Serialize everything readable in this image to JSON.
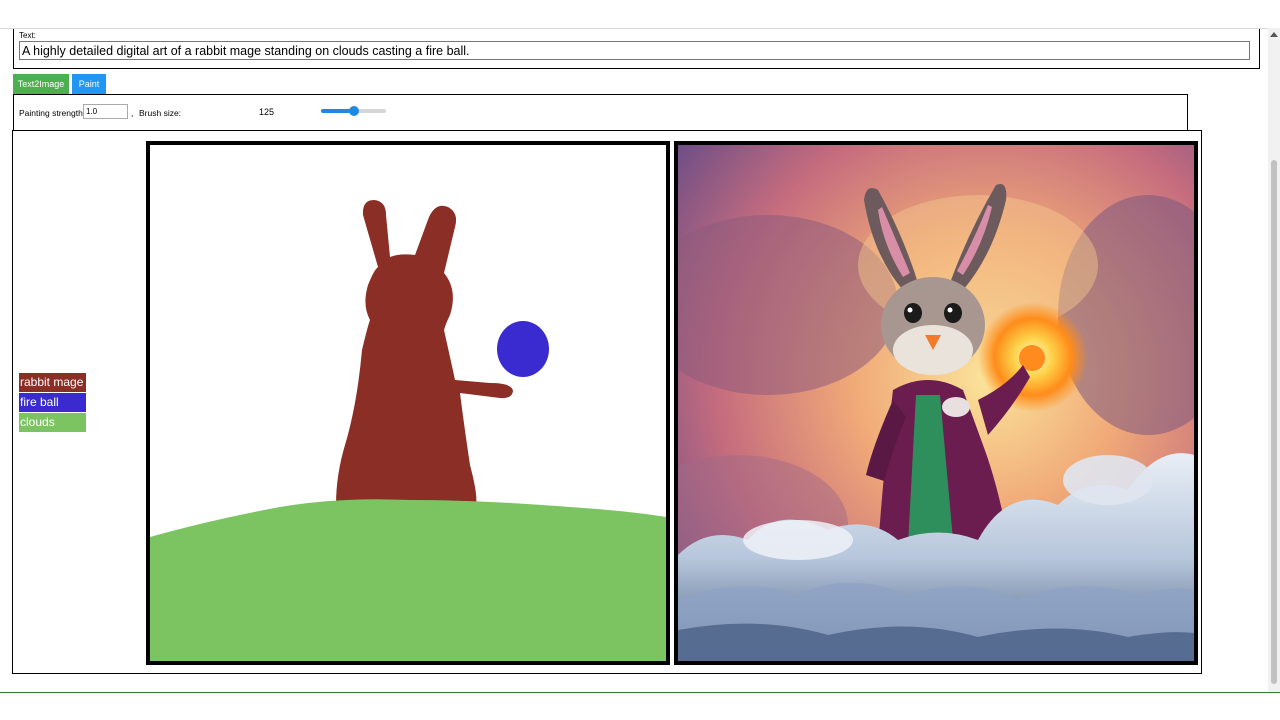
{
  "text_section": {
    "label": "Text:",
    "prompt_value": "A highly detailed digital art of a rabbit mage standing on clouds casting a fire ball."
  },
  "tabs": [
    {
      "label": "Text2Image",
      "color": "#4caf50"
    },
    {
      "label": "Paint",
      "color": "#2196f3"
    }
  ],
  "controls": {
    "painting_strength_label": "Painting strength:",
    "painting_strength_value": "1.0",
    "separator": ",",
    "brush_size_label": "Brush size:",
    "brush_size_value": "125",
    "brush_slider_fraction": 0.5
  },
  "legend": [
    {
      "label": "rabbit mage",
      "color": "#8b2e25"
    },
    {
      "label": "fire ball",
      "color": "#3a2bd0"
    },
    {
      "label": "clouds",
      "color": "#7cc462"
    }
  ],
  "icons": {
    "scroll_up": "chevron-up-icon"
  }
}
